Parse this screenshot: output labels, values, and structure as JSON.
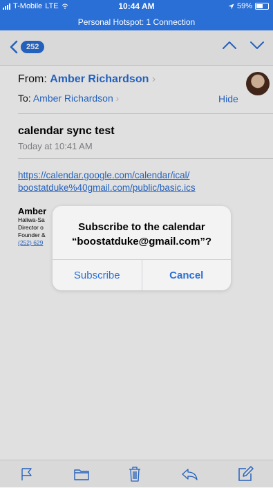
{
  "status_bar": {
    "carrier": "T-Mobile",
    "network": "LTE",
    "time": "10:44 AM",
    "battery": "59%",
    "battery_level": 0.59,
    "hotspot": "Personal Hotspot: 1 Connection"
  },
  "nav": {
    "unread_count": "252"
  },
  "header": {
    "from_label": "From:",
    "from_name": "Amber Richardson",
    "to_label": "To:",
    "to_name": "Amber Richardson",
    "hide_label": "Hide"
  },
  "message": {
    "subject": "calendar sync test",
    "date": "Today at 10:41 AM",
    "link_line1": "https://calendar.google.com/calendar/ical/",
    "link_line2": "boostatduke%40gmail.com/public/basic.ics"
  },
  "signature": {
    "name": "Amber",
    "line1": "Haliwa-Sa",
    "line2": "Director o",
    "line3": "Founder &",
    "phone": "(252) 629"
  },
  "alert": {
    "line1": "Subscribe to the calendar",
    "line2": "“boostatduke@gmail.com”?",
    "subscribe_label": "Subscribe",
    "cancel_label": "Cancel"
  },
  "colors": {
    "accent": "#2a6fd6",
    "status_bar_bg": "#2a6fd6"
  },
  "toolbar": {
    "icons": [
      "flag-icon",
      "folder-icon",
      "trash-icon",
      "reply-icon",
      "compose-icon"
    ]
  }
}
